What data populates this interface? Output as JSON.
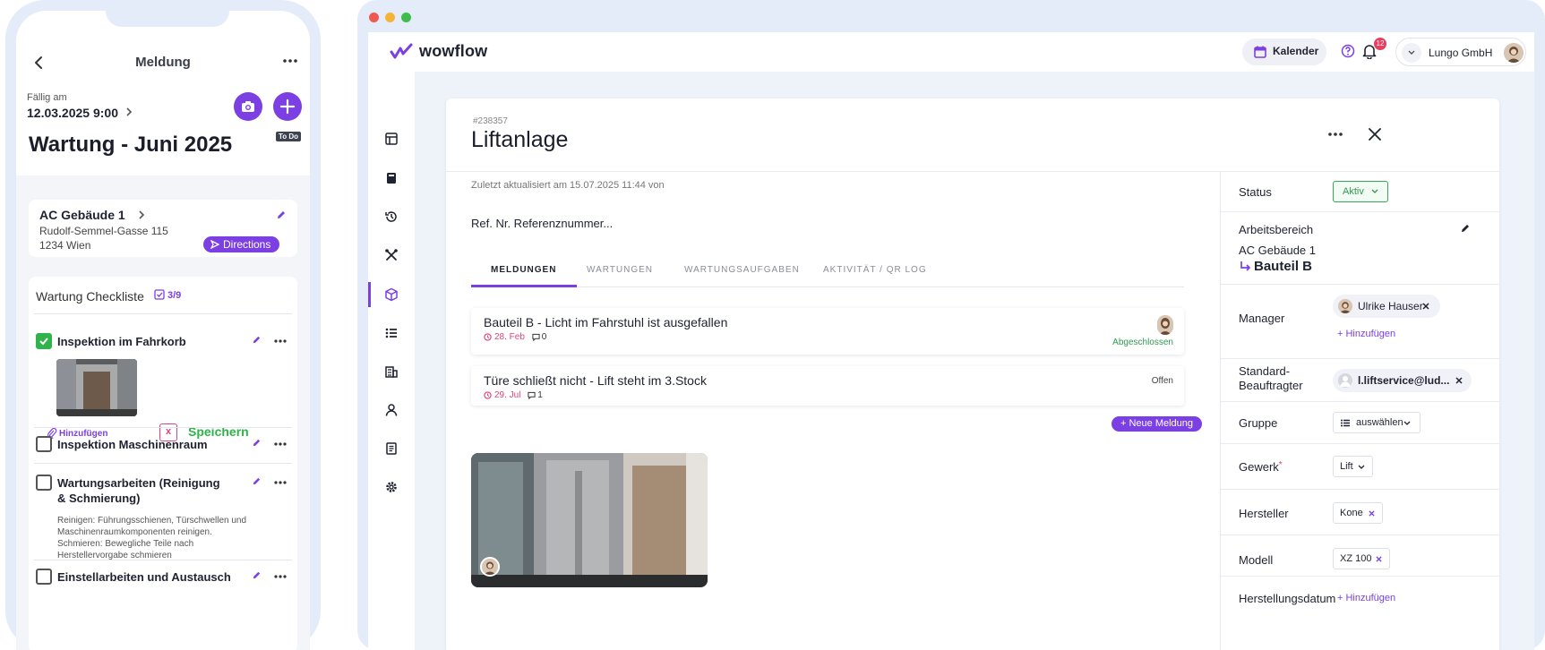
{
  "phone": {
    "nav_title": "Meldung",
    "due_label": "Fällig am",
    "due_value": "12.03.2025 9:00",
    "todo_badge": "To Do",
    "title": "Wartung - Juni 2025",
    "location": {
      "building": "AC Gebäude 1",
      "street": "Rudolf-Semmel-Gasse 115",
      "city": "1234 Wien",
      "directions_label": "Directions"
    },
    "checklist": {
      "title": "Wartung Checkliste",
      "count": "3/9",
      "items": [
        {
          "label": "Inspektion im Fahrkorb",
          "checked": true
        },
        {
          "label": "Inspektion Maschinenraum",
          "checked": false
        },
        {
          "label": "Wartungsarbeiten (Reinigung & Schmierung)",
          "checked": false,
          "description": "Reinigen: Führungsschienen, Türschwellen und Maschinenraumkomponenten reinigen. Schmieren: Bewegliche Teile nach Herstellervorgabe schmieren"
        },
        {
          "label": "Einstellarbeiten und Austausch",
          "checked": false
        }
      ],
      "attach_label": "Hinzufügen",
      "cancel_symbol": "x",
      "save_label": "Speichern"
    }
  },
  "app": {
    "brand": "wowflow",
    "calendar_label": "Kalender",
    "notification_count": "12",
    "org_name": "Lungo GmbH"
  },
  "detail": {
    "id": "#238357",
    "title": "Liftanlage",
    "updated": "Zuletzt aktualisiert am 15.07.2025 11:44  von",
    "reference": "Ref. Nr. Referenznummer...",
    "tabs": [
      "MELDUNGEN",
      "WARTUNGEN",
      "WARTUNGSAUFGABEN",
      "AKTIVITÄT / QR LOG"
    ],
    "messages": [
      {
        "title": "Bauteil B - Licht im Fahrstuhl ist ausgefallen",
        "date": "28. Feb",
        "comments": "0",
        "status": "Abgeschlossen",
        "status_color": "#2f9a4f"
      },
      {
        "title": "Türe schließt nicht - Lift steht im 3.Stock",
        "date": "29. Jul",
        "comments": "1",
        "status": "Offen",
        "status_color": "#444444"
      }
    ],
    "new_message_label": "+ Neue Meldung"
  },
  "properties": {
    "status": {
      "label": "Status",
      "value": "Aktiv"
    },
    "area": {
      "label": "Arbeitsbereich",
      "building": "AC Gebäude 1",
      "part": "Bauteil B"
    },
    "manager": {
      "label": "Manager",
      "person": "Ulrike Hauser",
      "add": "+ Hinzufügen"
    },
    "default_assignee": {
      "label": "Standard-Beauftragter",
      "value": "l.liftservice@lud..."
    },
    "group": {
      "label": "Gruppe",
      "value": "auswählen"
    },
    "trade": {
      "label": "Gewerk",
      "required_mark": "*",
      "value": "Lift"
    },
    "manufacturer": {
      "label": "Hersteller",
      "value": "Kone"
    },
    "model": {
      "label": "Modell",
      "value": "XZ 100"
    },
    "manufacture_date": {
      "label": "Herstellungsdatum",
      "add": "+ Hinzufügen"
    }
  },
  "colors": {
    "accent": "#7b3fe4",
    "success": "#2fb34a",
    "danger": "#e0457b"
  }
}
